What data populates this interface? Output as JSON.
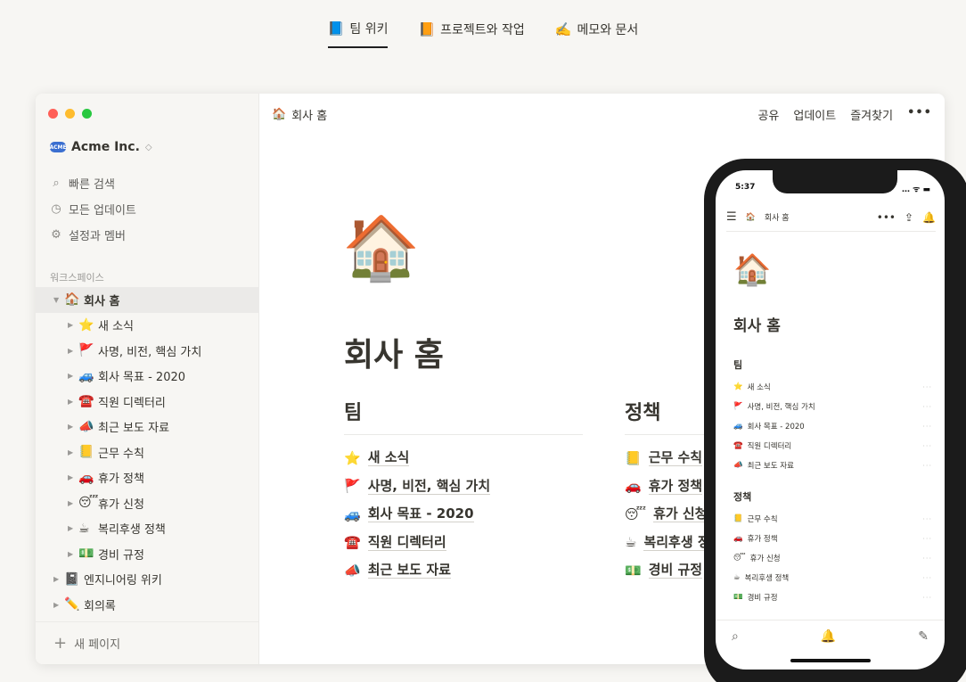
{
  "top_tabs": [
    {
      "icon": "📘",
      "label": "팀 위키",
      "active": true
    },
    {
      "icon": "📙",
      "label": "프로젝트와 작업",
      "active": false
    },
    {
      "icon": "✍️",
      "label": "메모와 문서",
      "active": false
    }
  ],
  "window": {
    "traffic_colors": [
      "#ff5f57",
      "#febc2e",
      "#28c840"
    ],
    "workspace": {
      "logo": "ACME",
      "name": "Acme Inc.",
      "caret": "◇"
    },
    "nav": [
      {
        "icon": "search-icon",
        "glyph": "⌕",
        "label": "빠른 검색"
      },
      {
        "icon": "clock-icon",
        "glyph": "◷",
        "label": "모든 업데이트"
      },
      {
        "icon": "gear-icon",
        "glyph": "⚙",
        "label": "설정과 멤버"
      }
    ],
    "section_label": "워크스페이스",
    "tree": [
      {
        "emoji": "🏠",
        "label": "회사 홈",
        "depth": 0,
        "selected": true,
        "expanded": true
      },
      {
        "emoji": "⭐",
        "label": "새 소식",
        "depth": 1
      },
      {
        "emoji": "🚩",
        "label": "사명, 비전, 핵심 가치",
        "depth": 1
      },
      {
        "emoji": "🚙",
        "label": "회사 목표 - 2020",
        "depth": 1
      },
      {
        "emoji": "☎️",
        "label": "직원 디렉터리",
        "depth": 1
      },
      {
        "emoji": "📣",
        "label": "최근 보도 자료",
        "depth": 1
      },
      {
        "emoji": "📒",
        "label": "근무 수칙",
        "depth": 1
      },
      {
        "emoji": "🚗",
        "label": "휴가 정책",
        "depth": 1
      },
      {
        "emoji": "😴",
        "label": "휴가 신청",
        "depth": 1
      },
      {
        "emoji": "☕",
        "label": "복리후생 정책",
        "depth": 1
      },
      {
        "emoji": "💵",
        "label": "경비 규정",
        "depth": 1
      },
      {
        "emoji": "📓",
        "label": "엔지니어링 위키",
        "depth": 0
      },
      {
        "emoji": "✏️",
        "label": "회의록",
        "depth": 0
      }
    ],
    "new_page": "새 페이지",
    "breadcrumb": {
      "emoji": "🏠",
      "label": "회사 홈"
    },
    "actions": [
      "공유",
      "업데이트",
      "즐겨찾기",
      "•••"
    ],
    "page": {
      "icon": "🏠",
      "title": "회사 홈",
      "team": {
        "title": "팀",
        "items": [
          {
            "emoji": "⭐",
            "label": "새 소식"
          },
          {
            "emoji": "🚩",
            "label": "사명, 비전, 핵심 가치"
          },
          {
            "emoji": "🚙",
            "label": "회사 목표 - 2020"
          },
          {
            "emoji": "☎️",
            "label": "직원 디렉터리"
          },
          {
            "emoji": "📣",
            "label": "최근 보도 자료"
          }
        ]
      },
      "policy": {
        "title": "정책",
        "items": [
          {
            "emoji": "📒",
            "label": "근무 수칙"
          },
          {
            "emoji": "🚗",
            "label": "휴가 정책"
          },
          {
            "emoji": "😴",
            "label": "휴가 신청"
          },
          {
            "emoji": "☕",
            "label": "복리후생 정"
          },
          {
            "emoji": "💵",
            "label": "경비 규정"
          }
        ]
      }
    }
  },
  "phone": {
    "time": "5:37",
    "status_right": "…  ᯤ ▬",
    "header": {
      "emoji": "🏠",
      "label": "회사 홈"
    },
    "header_actions": [
      "•••",
      "⇪",
      "🔔"
    ],
    "icon": "🏠",
    "title": "회사 홈",
    "team": {
      "title": "팀",
      "items": [
        {
          "emoji": "⭐",
          "label": "새 소식"
        },
        {
          "emoji": "🚩",
          "label": "사명, 비전, 핵심 가치"
        },
        {
          "emoji": "🚙",
          "label": "회사 목표 - 2020"
        },
        {
          "emoji": "☎️",
          "label": "직원 디렉터리"
        },
        {
          "emoji": "📣",
          "label": "최근 보도 자료"
        }
      ]
    },
    "policy": {
      "title": "정책",
      "items": [
        {
          "emoji": "📒",
          "label": "근무 수칙"
        },
        {
          "emoji": "🚗",
          "label": "휴가 정책"
        },
        {
          "emoji": "😴",
          "label": "휴가 신청"
        },
        {
          "emoji": "☕",
          "label": "복리후생 정책"
        },
        {
          "emoji": "💵",
          "label": "경비 규정"
        }
      ]
    },
    "row_more": "···",
    "bottom_icons": [
      "⌕",
      "🔔",
      "✎"
    ]
  }
}
